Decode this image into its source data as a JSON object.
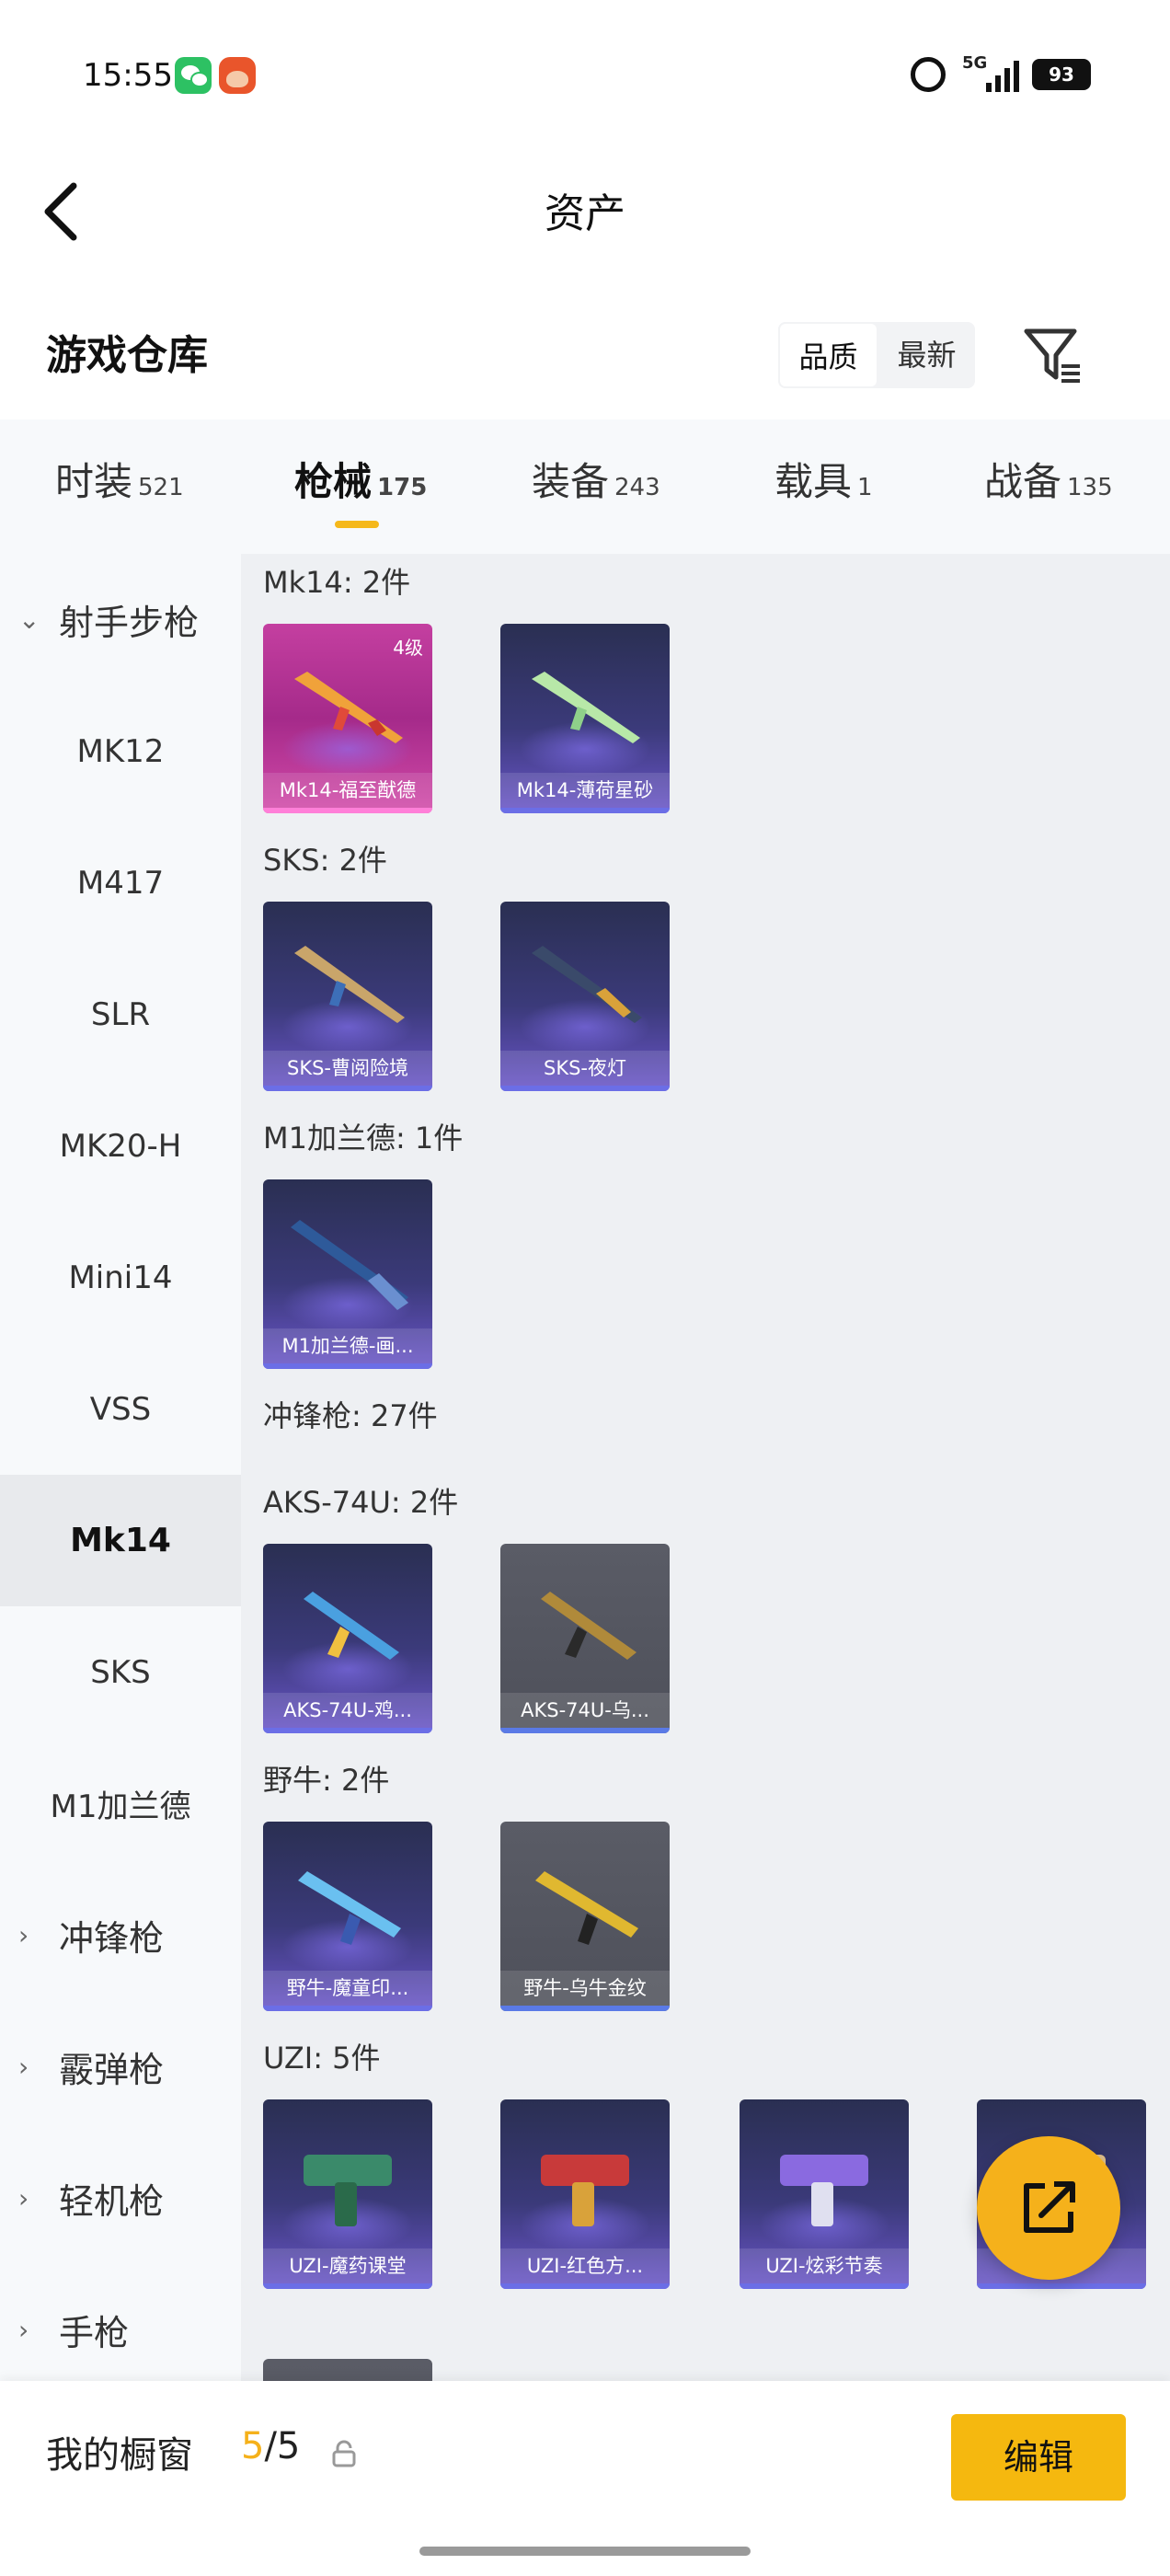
{
  "status_bar": {
    "time": "15:55",
    "network": "5G",
    "battery": "93"
  },
  "header": {
    "title": "资产"
  },
  "warehouse": {
    "title": "游戏仓库",
    "sort_options": [
      "品质",
      "最新"
    ],
    "active_sort": "品质"
  },
  "tabs": [
    {
      "label": "时装",
      "count": "521"
    },
    {
      "label": "枪械",
      "count": "175"
    },
    {
      "label": "装备",
      "count": "243"
    },
    {
      "label": "载具",
      "count": "1"
    },
    {
      "label": "战备",
      "count": "135"
    }
  ],
  "active_tab": "枪械",
  "sidebar": {
    "expanded_group": "射手步枪",
    "items": [
      "MK12",
      "M417",
      "SLR",
      "MK20-H",
      "Mini14",
      "VSS",
      "Mk14",
      "SKS",
      "M1加兰德"
    ],
    "active_item": "Mk14",
    "collapsed_groups": [
      "冲锋枪",
      "霰弹枪",
      "轻机枪",
      "手枪"
    ]
  },
  "sections": {
    "mk14": {
      "title": "Mk14: 2件",
      "cards": [
        "Mk14-福至猷德",
        "Mk14-薄荷星砂"
      ],
      "badge": "4级"
    },
    "sks": {
      "title": "SKS: 2件",
      "cards": [
        "SKS-曹阅险境",
        "SKS-夜灯"
      ]
    },
    "m1": {
      "title": "M1加兰德: 1件",
      "cards": [
        "M1加兰德-画..."
      ]
    },
    "smg": {
      "title": "冲锋枪: 27件"
    },
    "aks": {
      "title": "AKS-74U: 2件",
      "cards": [
        "AKS-74U-鸡...",
        "AKS-74U-乌..."
      ]
    },
    "bizon": {
      "title": "野牛: 2件",
      "cards": [
        "野牛-魔童印...",
        "野牛-乌牛金纹"
      ]
    },
    "uzi": {
      "title": "UZI: 5件",
      "cards": [
        "UZI-魔药课堂",
        "UZI-红色方...",
        "UZI-炫彩节奏",
        ""
      ]
    }
  },
  "bottom": {
    "showcase_label": "我的橱窗",
    "showcase_current": "5",
    "showcase_total": "/5",
    "edit_label": "编辑"
  },
  "colors": {
    "accent": "#f5b11b",
    "active_tab_underline": "#f5b81b"
  }
}
